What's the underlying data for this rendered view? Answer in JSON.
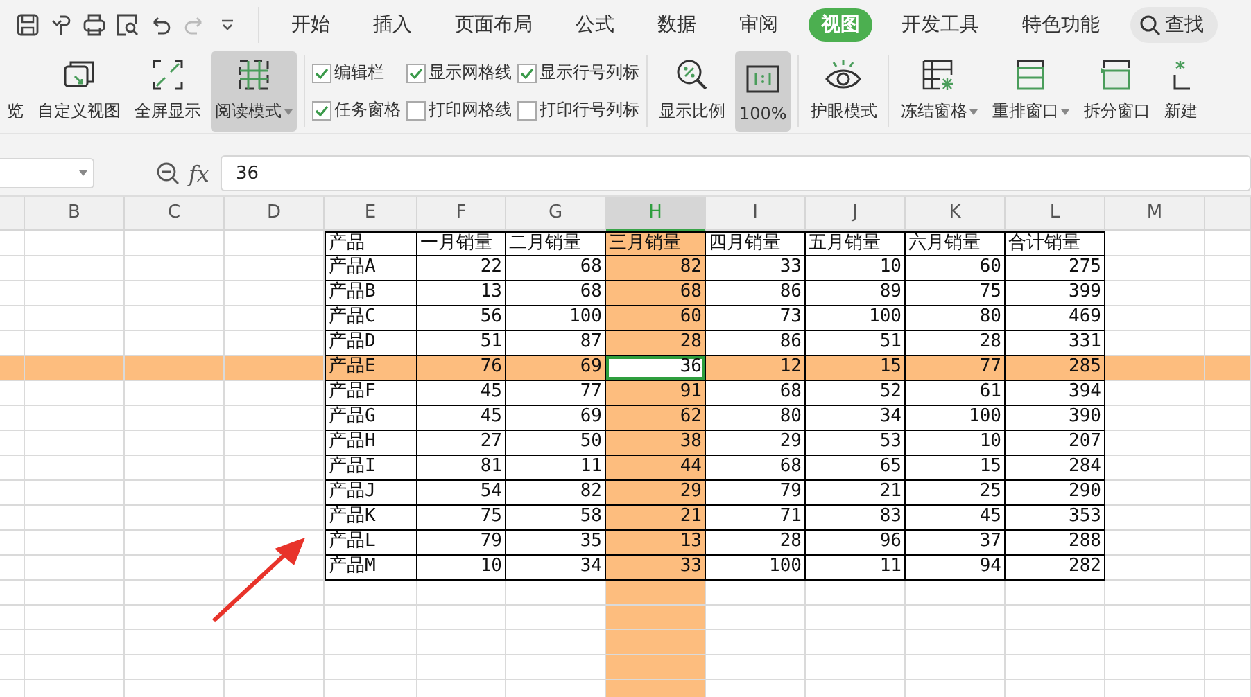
{
  "menu_tabs": [
    {
      "label": "开始",
      "selected": false
    },
    {
      "label": "插入",
      "selected": false
    },
    {
      "label": "页面布局",
      "selected": false
    },
    {
      "label": "公式",
      "selected": false
    },
    {
      "label": "数据",
      "selected": false
    },
    {
      "label": "审阅",
      "selected": false
    },
    {
      "label": "视图",
      "selected": true
    },
    {
      "label": "开发工具",
      "selected": false
    },
    {
      "label": "特色功能",
      "selected": false
    }
  ],
  "search": {
    "label": "查找"
  },
  "ribbon": [
    {
      "kind": "button",
      "label": "览",
      "selected": false,
      "dropdown": false
    },
    {
      "kind": "button",
      "label": "自定义视图",
      "selected": false,
      "dropdown": false
    },
    {
      "kind": "button",
      "label": "全屏显示",
      "selected": false,
      "dropdown": false
    },
    {
      "kind": "button",
      "label": "阅读模式",
      "selected": true,
      "dropdown": true
    },
    {
      "kind": "separator"
    },
    {
      "kind": "checks",
      "items": [
        {
          "label": "编辑栏",
          "checked": true
        },
        {
          "label": "任务窗格",
          "checked": true
        }
      ]
    },
    {
      "kind": "checks",
      "items": [
        {
          "label": "显示网格线",
          "checked": true
        },
        {
          "label": "打印网格线",
          "checked": false
        }
      ]
    },
    {
      "kind": "checks",
      "items": [
        {
          "label": "显示行号列标",
          "checked": true
        },
        {
          "label": "打印行号列标",
          "checked": false
        }
      ]
    },
    {
      "kind": "separator"
    },
    {
      "kind": "button",
      "label": "显示比例",
      "selected": false,
      "dropdown": false
    },
    {
      "kind": "button",
      "label": "100%",
      "selected": true,
      "dropdown": false
    },
    {
      "kind": "separator"
    },
    {
      "kind": "button",
      "label": "护眼模式",
      "selected": false,
      "dropdown": false
    },
    {
      "kind": "separator"
    },
    {
      "kind": "button",
      "label": "冻结窗格",
      "selected": false,
      "dropdown": true
    },
    {
      "kind": "button",
      "label": "重排窗口",
      "selected": false,
      "dropdown": true
    },
    {
      "kind": "button",
      "label": "拆分窗口",
      "selected": false,
      "dropdown": false
    },
    {
      "kind": "button",
      "label": "新建",
      "selected": false,
      "dropdown": false
    }
  ],
  "formula_bar": {
    "function_label": "fx",
    "value": "36"
  },
  "columns": [
    {
      "label": "B",
      "selected": false
    },
    {
      "label": "C",
      "selected": false
    },
    {
      "label": "D",
      "selected": false
    },
    {
      "label": "E",
      "selected": false
    },
    {
      "label": "F",
      "selected": false
    },
    {
      "label": "G",
      "selected": false
    },
    {
      "label": "H",
      "selected": true
    },
    {
      "label": "I",
      "selected": false
    },
    {
      "label": "J",
      "selected": false
    },
    {
      "label": "K",
      "selected": false
    },
    {
      "label": "L",
      "selected": false
    },
    {
      "label": "M",
      "selected": false
    }
  ],
  "table": {
    "rows": [
      {
        "selected": false,
        "cells": [
          "产品",
          "一月销量",
          "二月销量",
          "三月销量",
          "四月销量",
          "五月销量",
          "六月销量",
          "合计销量"
        ]
      },
      {
        "selected": false,
        "cells": [
          "产品A",
          "22",
          "68",
          "82",
          "33",
          "10",
          "60",
          "275"
        ]
      },
      {
        "selected": false,
        "cells": [
          "产品B",
          "13",
          "68",
          "68",
          "86",
          "89",
          "75",
          "399"
        ]
      },
      {
        "selected": false,
        "cells": [
          "产品C",
          "56",
          "100",
          "60",
          "73",
          "100",
          "80",
          "469"
        ]
      },
      {
        "selected": false,
        "cells": [
          "产品D",
          "51",
          "87",
          "28",
          "86",
          "51",
          "28",
          "331"
        ]
      },
      {
        "selected": true,
        "cells": [
          "产品E",
          "76",
          "69",
          "36",
          "12",
          "15",
          "77",
          "285"
        ]
      },
      {
        "selected": false,
        "cells": [
          "产品F",
          "45",
          "77",
          "91",
          "68",
          "52",
          "61",
          "394"
        ]
      },
      {
        "selected": false,
        "cells": [
          "产品G",
          "45",
          "69",
          "62",
          "80",
          "34",
          "100",
          "390"
        ]
      },
      {
        "selected": false,
        "cells": [
          "产品H",
          "27",
          "50",
          "38",
          "29",
          "53",
          "10",
          "207"
        ]
      },
      {
        "selected": false,
        "cells": [
          "产品I",
          "81",
          "11",
          "44",
          "68",
          "65",
          "15",
          "284"
        ]
      },
      {
        "selected": false,
        "cells": [
          "产品J",
          "54",
          "82",
          "29",
          "79",
          "21",
          "25",
          "290"
        ]
      },
      {
        "selected": false,
        "cells": [
          "产品K",
          "75",
          "58",
          "21",
          "71",
          "83",
          "45",
          "353"
        ]
      },
      {
        "selected": false,
        "cells": [
          "产品L",
          "79",
          "35",
          "13",
          "28",
          "96",
          "37",
          "288"
        ]
      },
      {
        "selected": false,
        "cells": [
          "产品M",
          "10",
          "34",
          "33",
          "100",
          "11",
          "94",
          "282"
        ]
      }
    ]
  }
}
